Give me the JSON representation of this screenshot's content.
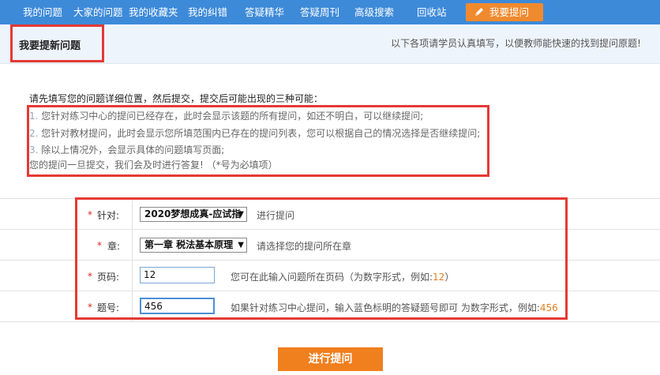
{
  "nav": {
    "items": [
      "我的问题",
      "大家的问题",
      "我的收藏夹",
      "我的纠错",
      "答疑精华",
      "答疑周刊",
      "高级搜索",
      "回收站"
    ],
    "ask_label": "我要提问"
  },
  "header": {
    "title": "我要提新问题",
    "note": "以下各项请学员认真填写，以便教师能快速的找到提问原题!"
  },
  "instructions": {
    "heading": "请先填写您的问题详细位置，然后提交，提交后可能出现的三种可能：",
    "lines": [
      {
        "num": "1.",
        "text": "您针对练习中心的提问已经存在，此时会显示该题的所有提问，如还不明白，可以继续提问;"
      },
      {
        "num": "2.",
        "text": "您针对教材提问，此时会显示您所填范围内已存在的提问列表，您可以根据自己的情况选择是否继续提问;"
      },
      {
        "num": "3.",
        "text": "除以上情况外，会显示具体的问题填写页面;"
      }
    ],
    "footer": "您的提问一旦提交，我们会及时进行答复! （*号为必填项）"
  },
  "form": {
    "required_mark": "*",
    "target": {
      "label": "针对:",
      "selected": "2020梦想成真-应试指",
      "hint": "进行提问"
    },
    "chapter": {
      "label": "章:",
      "selected": "第一章 税法基本原理",
      "hint": "请选择您的提问所在章"
    },
    "page": {
      "label": "页码:",
      "value": "12",
      "hint": "您可在此输入问题所在页码（为数字形式，例如:",
      "example": "12",
      "close": "）"
    },
    "question": {
      "label": "题号:",
      "value": "456",
      "hint": "如果针对练习中心提问，输入蓝色标明的答疑题号即可  为数字形式，例如:",
      "example": "456"
    }
  },
  "submit_label": "进行提问",
  "colors": {
    "nav_bg": "#3d8ad9",
    "accent_orange": "#f08a2e",
    "required_red": "#e02424",
    "annotation_red": "#e53935"
  }
}
